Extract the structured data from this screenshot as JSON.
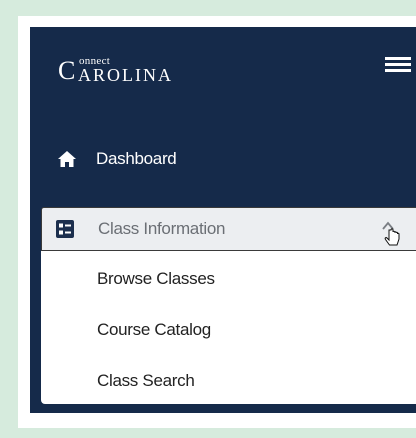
{
  "brand": {
    "logo_c": "C",
    "logo_connect": "onnect",
    "logo_rest": "AROLINA"
  },
  "header": {
    "menu_icon": "hamburger-menu-icon"
  },
  "nav": {
    "dashboard": {
      "label": "Dashboard",
      "icon": "home-icon"
    },
    "class_info": {
      "label": "Class Information",
      "icon": "list-card-icon",
      "expanded": true,
      "caret_icon": "chevron-up-icon"
    },
    "submenu": [
      {
        "label": "Browse Classes"
      },
      {
        "label": "Course Catalog"
      },
      {
        "label": "Class Search"
      }
    ]
  },
  "colors": {
    "panel": "#152a4a",
    "page_bg": "#d6ebdd",
    "selected_bg": "#eceef1"
  }
}
